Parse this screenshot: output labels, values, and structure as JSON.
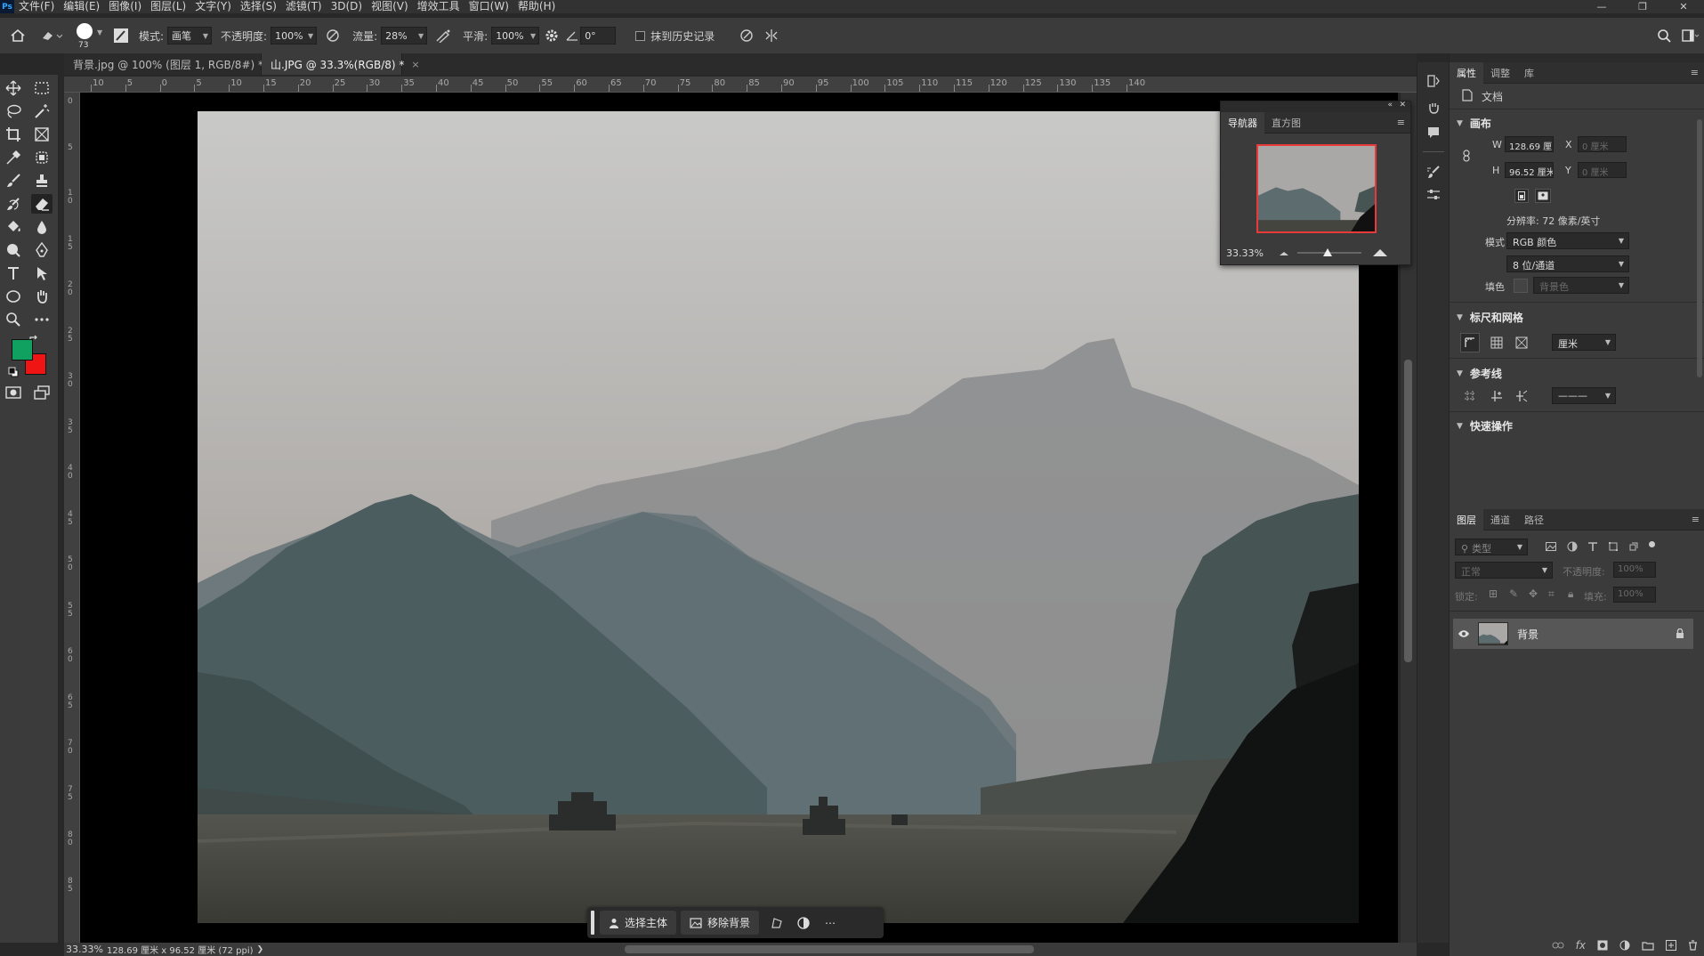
{
  "app": {
    "logo": "Ps"
  },
  "menu": [
    "文件(F)",
    "编辑(E)",
    "图像(I)",
    "图层(L)",
    "文字(Y)",
    "选择(S)",
    "滤镜(T)",
    "3D(D)",
    "视图(V)",
    "增效工具",
    "窗口(W)",
    "帮助(H)"
  ],
  "window_controls": {
    "minimize": "—",
    "maximize": "❐",
    "close": "✕"
  },
  "options": {
    "brush_size": "73",
    "mode_label": "模式:",
    "mode_value": "画笔",
    "opacity_label": "不透明度:",
    "opacity_value": "100%",
    "flow_label": "流量:",
    "flow_value": "28%",
    "smoothing_label": "平滑:",
    "smoothing_value": "100%",
    "angle_value": "0°",
    "history_label": "抹到历史记录"
  },
  "tabs": [
    {
      "label": "背景.jpg @ 100% (图层 1, RGB/8#) *",
      "close": "×"
    },
    {
      "label": "山.JPG @ 33.3%(RGB/8) *",
      "close": "×"
    }
  ],
  "ruler_top": [
    "10",
    "5",
    "0",
    "5",
    "10",
    "15",
    "20",
    "25",
    "30",
    "35",
    "40",
    "45",
    "50",
    "55",
    "60",
    "65",
    "70",
    "75",
    "80",
    "85",
    "90",
    "95",
    "100",
    "105",
    "110",
    "115",
    "120",
    "125",
    "130",
    "135",
    "140"
  ],
  "ruler_left": [
    "0",
    "5",
    "1 0",
    "1 5",
    "2 0",
    "2 5",
    "3 0",
    "3 5",
    "4 0",
    "4 5",
    "5 0",
    "5 5",
    "6 0",
    "6 5",
    "7 0",
    "7 5",
    "8 0",
    "8 5"
  ],
  "context_bar": {
    "select_subject": "选择主体",
    "remove_bg": "移除背景",
    "more": "⋯"
  },
  "status": {
    "zoom": "33.33%",
    "doc_size": "128.69 厘米 x 96.52 厘米 (72 ppi)",
    "arrow": "❯"
  },
  "navigator": {
    "tab_navigator": "导航器",
    "tab_histogram": "直方图",
    "zoom": "33.33%"
  },
  "properties": {
    "tabs": [
      "属性",
      "调整",
      "库"
    ],
    "doc_label": "文档",
    "canvas_title": "画布",
    "w_label": "W",
    "w_value": "128.69 厘",
    "h_label": "H",
    "h_value": "96.52 厘米",
    "x_label": "X",
    "x_value": "0 厘米",
    "y_label": "Y",
    "y_value": "0 厘米",
    "resolution": "分辨率: 72 像素/英寸",
    "mode_label": "模式",
    "mode_value": "RGB 颜色",
    "depth_value": "8 位/通道",
    "fill_label": "填色",
    "fill_value": "背景色",
    "rulers_title": "标尺和网格",
    "units_value": "厘米",
    "guides_title": "参考线",
    "guide_style": "———",
    "quick_actions_title": "快速操作"
  },
  "layers": {
    "tabs": [
      "图层",
      "通道",
      "路径"
    ],
    "filter_placeholder": "类型",
    "blend_value": "正常",
    "opacity_label": "不透明度:",
    "opacity_value": "100%",
    "lock_label": "锁定:",
    "fill_label": "填充:",
    "fill_value": "100%",
    "layer_name": "背景",
    "footer_fx": "fx"
  },
  "colors": {
    "foreground": "#10a060",
    "background": "#f01515",
    "accent_red": "#e83a3a"
  }
}
